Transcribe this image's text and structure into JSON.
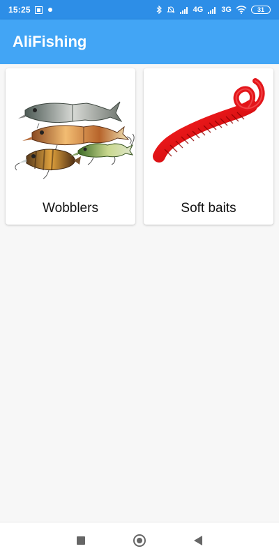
{
  "status_bar": {
    "time": "15:25",
    "network_1": "4G",
    "network_2": "3G",
    "battery": "31",
    "icons": [
      "notification-box-icon",
      "app-dot-icon",
      "bluetooth-icon",
      "alarm-off-icon",
      "signal-icon",
      "signal-icon",
      "wifi-icon",
      "battery-icon"
    ]
  },
  "app_bar": {
    "title": "AliFishing",
    "color": "#42a5f5"
  },
  "categories": [
    {
      "label": "Wobblers",
      "image_icon": "wobbler-lures-icon"
    },
    {
      "label": "Soft baits",
      "image_icon": "soft-bait-worm-icon"
    }
  ],
  "navigation_bar": {
    "buttons": [
      "recent-apps-icon",
      "home-icon",
      "back-icon"
    ]
  }
}
